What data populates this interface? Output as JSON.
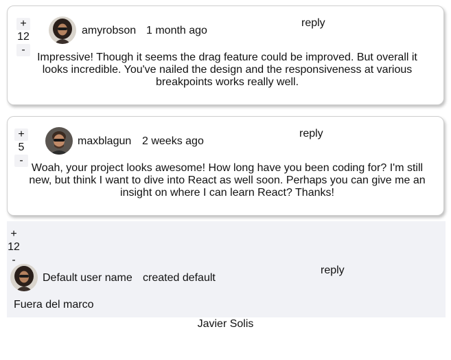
{
  "comments": [
    {
      "vote_plus": "+",
      "score": "12",
      "vote_minus": "-",
      "username": "amyrobson",
      "date": "1 month ago",
      "reply_label": "reply",
      "body": "Impressive! Though it seems the drag feature could be improved. But overall it looks incredible. You've nailed the design and the responsiveness at various breakpoints works really well."
    },
    {
      "vote_plus": "+",
      "score": "5",
      "vote_minus": "-",
      "username": "maxblagun",
      "date": "2 weeks ago",
      "reply_label": "reply",
      "body": "Woah, your project looks awesome! How long have you been coding for? I'm still new, but think I want to dive into React as well soon. Perhaps you can give me an insight on where I can learn React? Thanks!"
    },
    {
      "vote_plus": "+",
      "score": "12",
      "vote_minus": "-",
      "username": "Default user name",
      "date": "created default",
      "reply_label": "reply",
      "body": "Fuera del marco"
    }
  ],
  "footer": {
    "author": "Javier Solis"
  },
  "colors": {
    "card_border": "#cfcfcf",
    "section_bg": "#f1f2f6",
    "vote_bg": "#f2f2f5"
  }
}
